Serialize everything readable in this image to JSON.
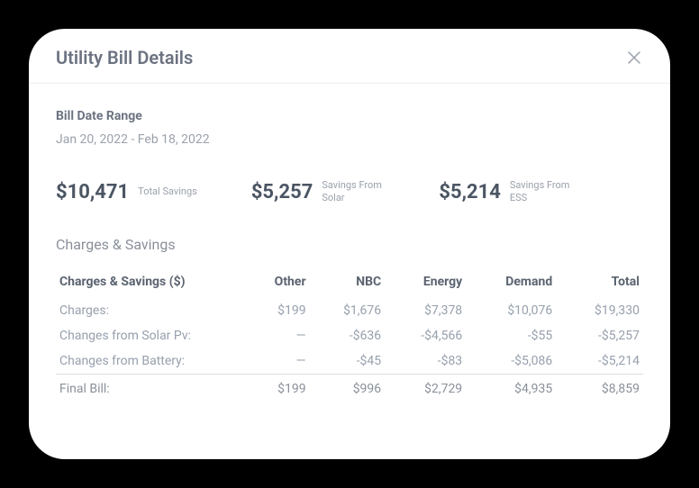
{
  "title": "Utility Bill Details",
  "billDate": {
    "label": "Bill Date Range",
    "range": "Jan 20, 2022 - Feb 18, 2022"
  },
  "metrics": [
    {
      "value": "$10,471",
      "label": "Total Savings"
    },
    {
      "value": "$5,257",
      "label": "Savings From Solar"
    },
    {
      "value": "$5,214",
      "label": "Savings From ESS"
    }
  ],
  "chargesSection": {
    "title": "Charges & Savings",
    "tableHeader": "Charges & Savings ($)",
    "columns": [
      "Other",
      "NBC",
      "Energy",
      "Demand",
      "Total"
    ],
    "rows": [
      {
        "label": "Charges:",
        "cells": [
          "$199",
          "$1,676",
          "$7,378",
          "$10,076",
          "$19,330"
        ]
      },
      {
        "label": "Changes from Solar Pv:",
        "cells": [
          "—",
          "-$636",
          "-$4,566",
          "-$55",
          "-$5,257"
        ]
      },
      {
        "label": "Changes from Battery:",
        "cells": [
          "—",
          "-$45",
          "-$83",
          "-$5,086",
          "-$5,214"
        ]
      }
    ],
    "finalRow": {
      "label": "Final Bill:",
      "cells": [
        "$199",
        "$996",
        "$2,729",
        "$4,935",
        "$8,859"
      ]
    }
  }
}
